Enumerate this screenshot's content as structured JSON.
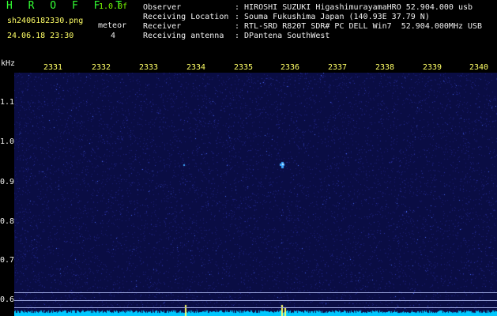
{
  "header": {
    "brand": "H R O F F T",
    "version": "1.0.0f",
    "filename": "sh2406182330.png",
    "datetime": "24.06.18 23:30",
    "mode_label": "meteor",
    "mode_value": "4"
  },
  "metadata": [
    {
      "key": "Observer",
      "value": ": HIROSHI SUZUKI HigashimurayamaHRO 52.904.000 usb"
    },
    {
      "key": "Receiving Location",
      "value": ": Souma Fukushima Japan (140.93E 37.79 N)"
    },
    {
      "key": "Receiver",
      "value": ": RTL-SRD R820T SDR# PC DELL Win7  52.904.000MHz USB"
    },
    {
      "key": "Receiving antenna",
      "value": ": DPantena SouthWest"
    }
  ],
  "axis": {
    "y_unit": "kHz",
    "x_ticks": [
      "2331",
      "2332",
      "2333",
      "2334",
      "2335",
      "2336",
      "2337",
      "2338",
      "2339",
      "2340"
    ],
    "y_ticks": [
      "1.1",
      "1.0",
      "0.9",
      "0.8",
      "0.7",
      "0.6"
    ]
  },
  "colors": {
    "background": "#000000",
    "waterfall": "#0a0d44",
    "header_green": "#33FF33",
    "tick_yellow": "#FFFF66",
    "signal_cyan": "#00E5FF",
    "grid_line": "#9fa9e0"
  }
}
